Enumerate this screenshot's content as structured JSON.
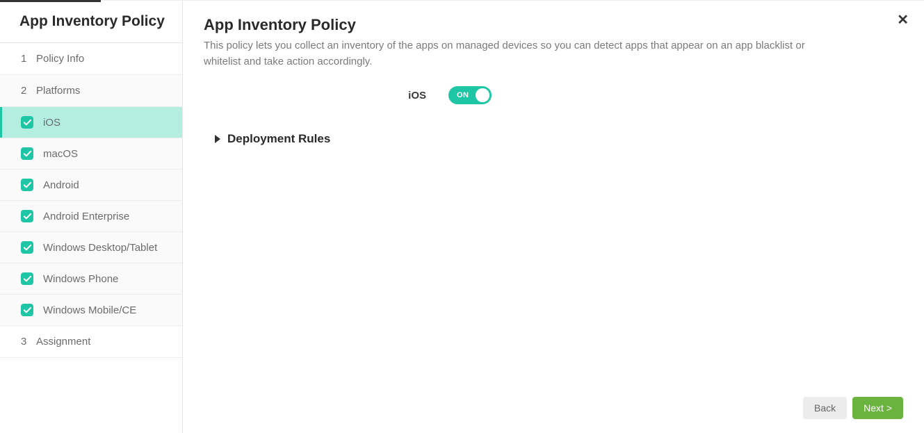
{
  "sidebar": {
    "title": "App Inventory Policy",
    "steps": {
      "1": {
        "num": "1",
        "label": "Policy Info"
      },
      "2": {
        "num": "2",
        "label": "Platforms"
      },
      "3": {
        "num": "3",
        "label": "Assignment"
      }
    },
    "platforms": [
      {
        "label": "iOS",
        "checked": true,
        "active": true
      },
      {
        "label": "macOS",
        "checked": true,
        "active": false
      },
      {
        "label": "Android",
        "checked": true,
        "active": false
      },
      {
        "label": "Android Enterprise",
        "checked": true,
        "active": false
      },
      {
        "label": "Windows Desktop/Tablet",
        "checked": true,
        "active": false
      },
      {
        "label": "Windows Phone",
        "checked": true,
        "active": false
      },
      {
        "label": "Windows Mobile/CE",
        "checked": true,
        "active": false
      }
    ]
  },
  "main": {
    "title": "App Inventory Policy",
    "description": "This policy lets you collect an inventory of the apps on managed devices so you can detect apps that appear on an app blacklist or whitelist and take action accordingly.",
    "toggle": {
      "label": "iOS",
      "state": "ON"
    },
    "section": "Deployment Rules"
  },
  "footer": {
    "back": "Back",
    "next": "Next >"
  },
  "colors": {
    "accent": "#1fc6a6",
    "activeBg": "#b4eee1",
    "nextBtn": "#6bb33f"
  }
}
